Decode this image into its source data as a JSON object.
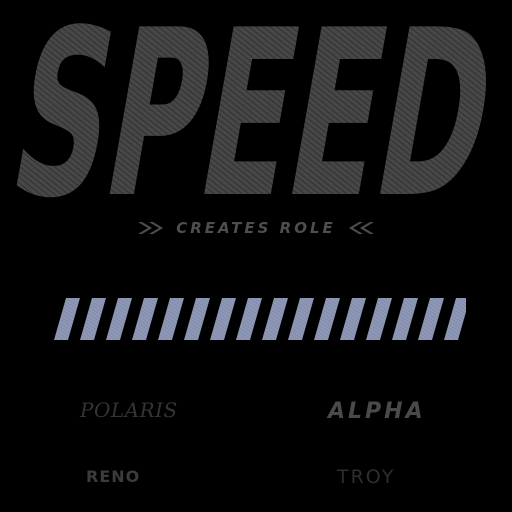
{
  "headline": {
    "text": "SPEED",
    "color": "#474747",
    "hatch_color": "#2a2a2a"
  },
  "tagline": {
    "text": "CREATES ROLE",
    "left_icon": "double-chevron-right-icon",
    "right_icon": "double-chevron-left-icon",
    "color": "#4e4e4e"
  },
  "stripe_bar": {
    "stripe_color": "#8e97b5",
    "stripe_count": 16
  },
  "brands": [
    {
      "name": "POLARIS"
    },
    {
      "name": "ALPHA"
    },
    {
      "name": "RENO"
    },
    {
      "name": "TROY"
    }
  ]
}
